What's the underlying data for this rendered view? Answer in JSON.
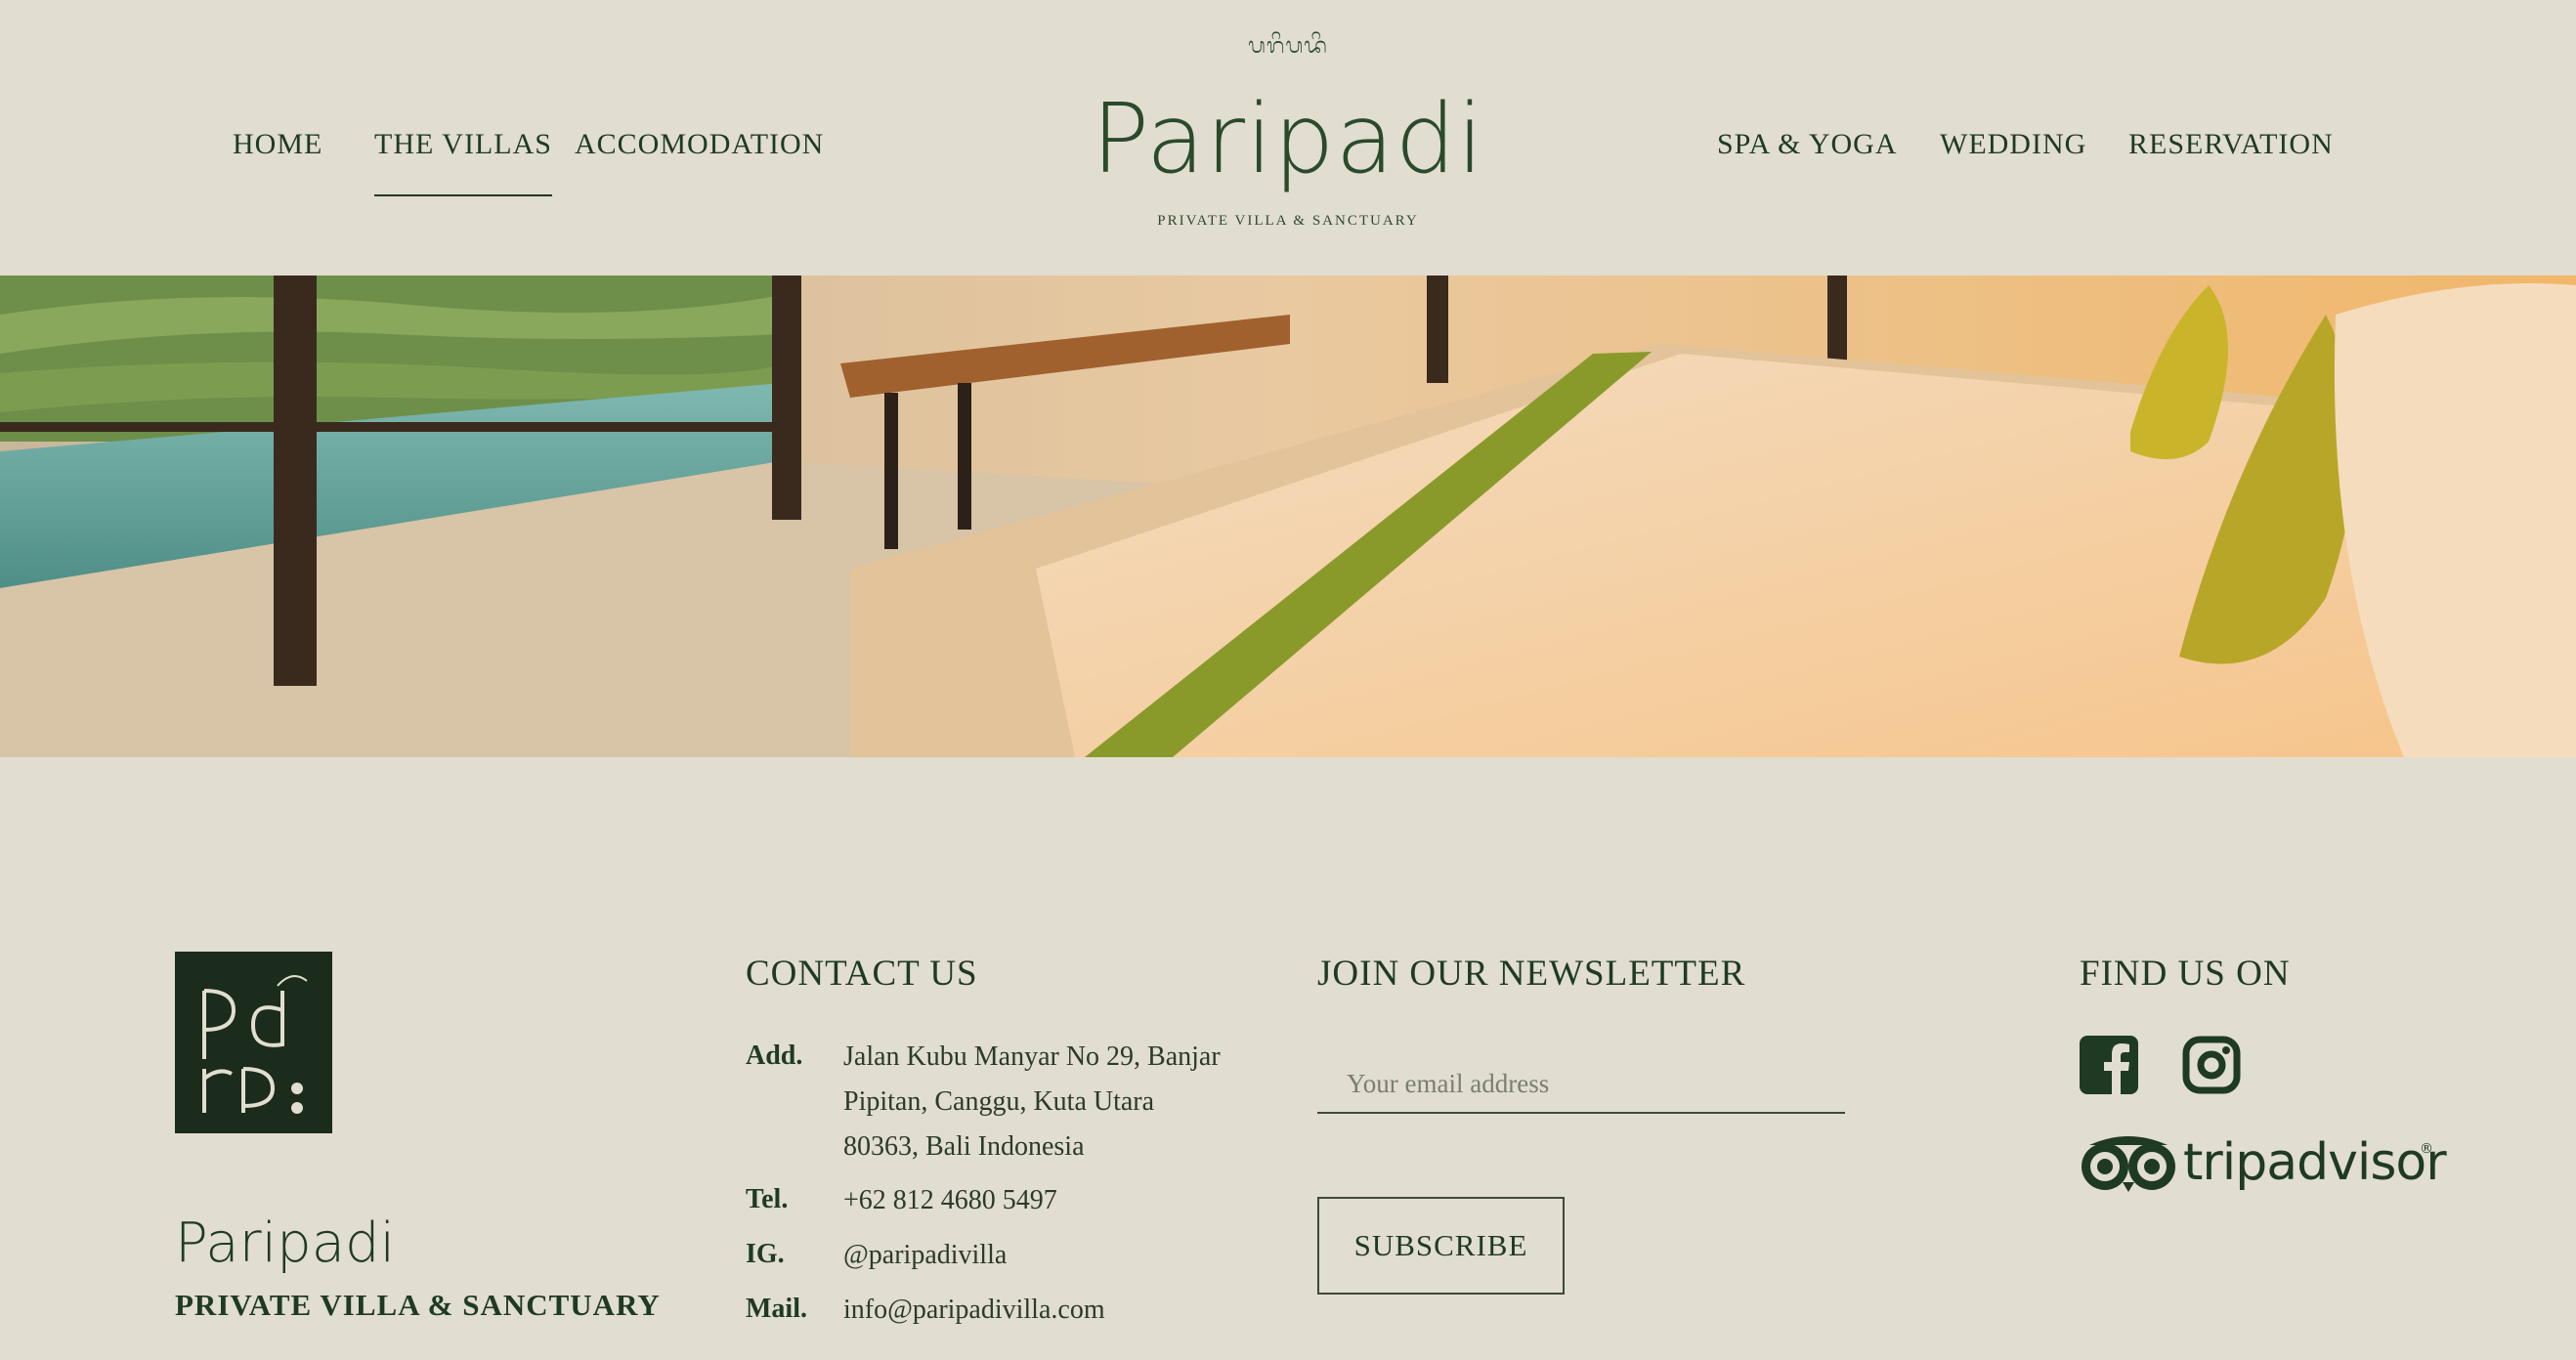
{
  "header": {
    "nav_left": [
      {
        "label": "HOME"
      },
      {
        "label": "THE VILLAS",
        "active": true
      },
      {
        "label": "ACCOMODATION"
      }
    ],
    "nav_right": [
      {
        "label": "SPA & YOGA"
      },
      {
        "label": "WEDDING"
      },
      {
        "label": "RESERVATION"
      }
    ],
    "brand": {
      "script": "ᬧᬭᬶᬧᬤᬶ",
      "name": "Paripadi",
      "tagline": "PRIVATE VILLA & SANCTUARY"
    }
  },
  "hero": {
    "image": "villa-bedroom-pool-rice-terrace"
  },
  "footer": {
    "brand_name": "Paripadi",
    "brand_tagline": "PRIVATE VILLA & SANCTUARY",
    "contact": {
      "title": "CONTACT US",
      "address_label": "Add.",
      "address_lines": [
        "Jalan Kubu Manyar No 29, Banjar",
        "Pipitan, Canggu, Kuta Utara",
        "80363, Bali Indonesia"
      ],
      "tel_label": "Tel.",
      "tel": "+62 812 4680 5497",
      "ig_label": "IG.",
      "ig": "@paripadivilla",
      "mail_label": "Mail.",
      "mail": "info@paripadivilla.com"
    },
    "newsletter": {
      "title": "JOIN OUR NEWSLETTER",
      "email_placeholder": "Your email address",
      "subscribe_label": "SUBSCRIBE"
    },
    "social": {
      "title": "FIND US ON",
      "icons": [
        "facebook-icon",
        "instagram-icon",
        "tripadvisor-icon"
      ],
      "tripadvisor_text": "tripadvisor",
      "registered": "®"
    }
  },
  "colors": {
    "background": "#e1ddd0",
    "primary_text": "#1f3a23",
    "logo_box": "#1b2b1c"
  }
}
